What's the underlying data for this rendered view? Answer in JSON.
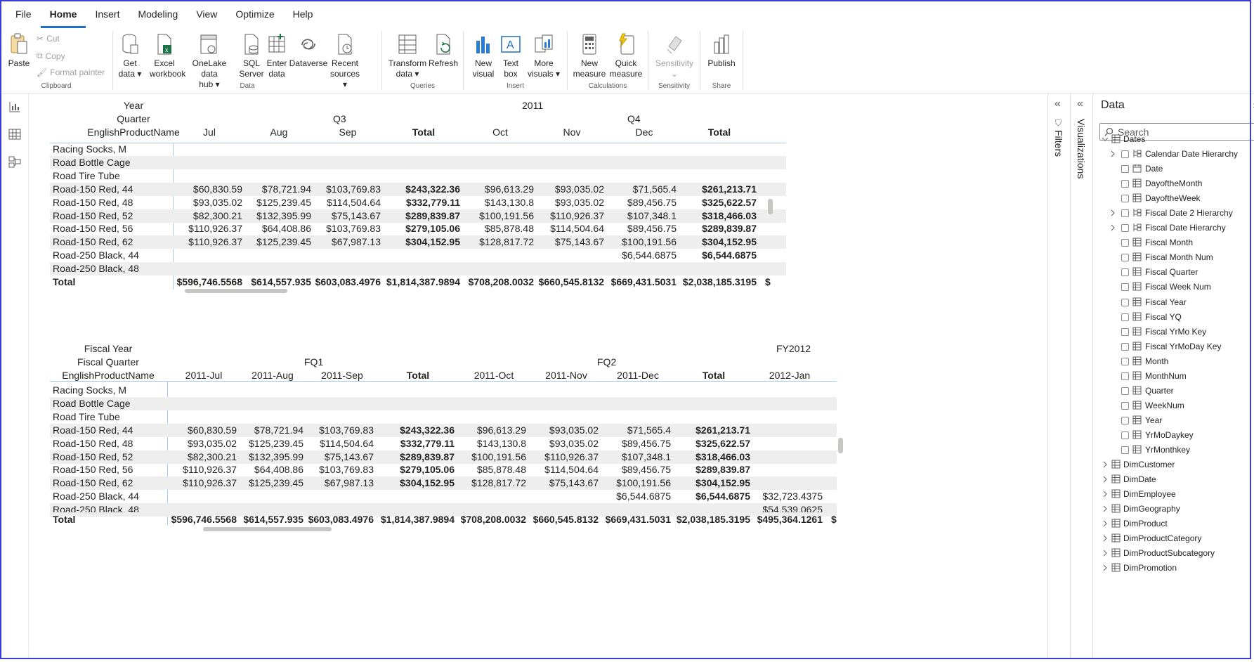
{
  "menu": {
    "items": [
      "File",
      "Home",
      "Insert",
      "Modeling",
      "View",
      "Optimize",
      "Help"
    ],
    "active": "Home"
  },
  "ribbon": {
    "clipboard": {
      "label": "Clipboard",
      "paste": "Paste",
      "cut": "Cut",
      "copy": "Copy",
      "format_painter": "Format painter"
    },
    "data": {
      "label": "Data",
      "get_data": [
        "Get",
        "data"
      ],
      "excel": [
        "Excel",
        "workbook"
      ],
      "onelake": [
        "OneLake data",
        "hub"
      ],
      "sql": [
        "SQL",
        "Server"
      ],
      "enter": [
        "Enter",
        "data"
      ],
      "dataverse": "Dataverse",
      "recent": [
        "Recent",
        "sources"
      ]
    },
    "queries": {
      "label": "Queries",
      "transform": [
        "Transform",
        "data"
      ],
      "refresh": "Refresh"
    },
    "insert": {
      "label": "Insert",
      "new_visual": [
        "New",
        "visual"
      ],
      "text_box": [
        "Text",
        "box"
      ],
      "more_visuals": [
        "More",
        "visuals"
      ]
    },
    "calculations": {
      "label": "Calculations",
      "new_measure": [
        "New",
        "measure"
      ],
      "quick_measure": [
        "Quick",
        "measure"
      ]
    },
    "sensitivity": {
      "label": "Sensitivity",
      "btn": "Sensitivity"
    },
    "share": {
      "label": "Share",
      "publish": "Publish"
    }
  },
  "matrix1": {
    "row_header_labels": [
      "Year",
      "Quarter",
      "EnglishProductName"
    ],
    "year": "2011",
    "quarters": [
      "Q3",
      "Q4"
    ],
    "columns": [
      "Jul",
      "Aug",
      "Sep",
      "Total",
      "Oct",
      "Nov",
      "Dec",
      "Total"
    ],
    "rows": [
      {
        "label": "Racing Socks, M",
        "values": [
          "",
          "",
          "",
          "",
          "",
          "",
          "",
          ""
        ]
      },
      {
        "label": "Road Bottle Cage",
        "values": [
          "",
          "",
          "",
          "",
          "",
          "",
          "",
          ""
        ]
      },
      {
        "label": "Road Tire Tube",
        "values": [
          "",
          "",
          "",
          "",
          "",
          "",
          "",
          ""
        ]
      },
      {
        "label": "Road-150 Red, 44",
        "values": [
          "$60,830.59",
          "$78,721.94",
          "$103,769.83",
          "$243,322.36",
          "$96,613.29",
          "$93,035.02",
          "$71,565.4",
          "$261,213.71"
        ]
      },
      {
        "label": "Road-150 Red, 48",
        "values": [
          "$93,035.02",
          "$125,239.45",
          "$114,504.64",
          "$332,779.11",
          "$143,130.8",
          "$93,035.02",
          "$89,456.75",
          "$325,622.57"
        ]
      },
      {
        "label": "Road-150 Red, 52",
        "values": [
          "$82,300.21",
          "$132,395.99",
          "$75,143.67",
          "$289,839.87",
          "$100,191.56",
          "$110,926.37",
          "$107,348.1",
          "$318,466.03"
        ]
      },
      {
        "label": "Road-150 Red, 56",
        "values": [
          "$110,926.37",
          "$64,408.86",
          "$103,769.83",
          "$279,105.06",
          "$85,878.48",
          "$114,504.64",
          "$89,456.75",
          "$289,839.87"
        ]
      },
      {
        "label": "Road-150 Red, 62",
        "values": [
          "$110,926.37",
          "$125,239.45",
          "$67,987.13",
          "$304,152.95",
          "$128,817.72",
          "$75,143.67",
          "$100,191.56",
          "$304,152.95"
        ]
      },
      {
        "label": "Road-250 Black, 44",
        "values": [
          "",
          "",
          "",
          "",
          "",
          "",
          "$6,544.6875",
          "$6,544.6875"
        ]
      },
      {
        "label": "Road-250 Black, 48",
        "values": [
          "",
          "",
          "",
          "",
          "",
          "",
          "",
          ""
        ]
      }
    ],
    "total": {
      "label": "Total",
      "values": [
        "$596,746.5568",
        "$614,557.935",
        "$603,083.4976",
        "$1,814,387.9894",
        "$708,208.0032",
        "$660,545.8132",
        "$669,431.5031",
        "$2,038,185.3195",
        "$"
      ]
    }
  },
  "matrix2": {
    "row_header_labels": [
      "Fiscal Year",
      "Fiscal Quarter",
      "EnglishProductName"
    ],
    "fiscal_year": "FY2012",
    "quarters": [
      "FQ1",
      "FQ2"
    ],
    "columns": [
      "2011-Jul",
      "2011-Aug",
      "2011-Sep",
      "Total",
      "2011-Oct",
      "2011-Nov",
      "2011-Dec",
      "Total",
      "2012-Jan"
    ],
    "rows": [
      {
        "label": "Racing Socks, M",
        "values": [
          "",
          "",
          "",
          "",
          "",
          "",
          "",
          "",
          ""
        ]
      },
      {
        "label": "Road Bottle Cage",
        "values": [
          "",
          "",
          "",
          "",
          "",
          "",
          "",
          "",
          ""
        ]
      },
      {
        "label": "Road Tire Tube",
        "values": [
          "",
          "",
          "",
          "",
          "",
          "",
          "",
          "",
          ""
        ]
      },
      {
        "label": "Road-150 Red, 44",
        "values": [
          "$60,830.59",
          "$78,721.94",
          "$103,769.83",
          "$243,322.36",
          "$96,613.29",
          "$93,035.02",
          "$71,565.4",
          "$261,213.71",
          ""
        ]
      },
      {
        "label": "Road-150 Red, 48",
        "values": [
          "$93,035.02",
          "$125,239.45",
          "$114,504.64",
          "$332,779.11",
          "$143,130.8",
          "$93,035.02",
          "$89,456.75",
          "$325,622.57",
          ""
        ]
      },
      {
        "label": "Road-150 Red, 52",
        "values": [
          "$82,300.21",
          "$132,395.99",
          "$75,143.67",
          "$289,839.87",
          "$100,191.56",
          "$110,926.37",
          "$107,348.1",
          "$318,466.03",
          ""
        ]
      },
      {
        "label": "Road-150 Red, 56",
        "values": [
          "$110,926.37",
          "$64,408.86",
          "$103,769.83",
          "$279,105.06",
          "$85,878.48",
          "$114,504.64",
          "$89,456.75",
          "$289,839.87",
          ""
        ]
      },
      {
        "label": "Road-150 Red, 62",
        "values": [
          "$110,926.37",
          "$125,239.45",
          "$67,987.13",
          "$304,152.95",
          "$128,817.72",
          "$75,143.67",
          "$100,191.56",
          "$304,152.95",
          ""
        ]
      },
      {
        "label": "Road-250 Black, 44",
        "values": [
          "",
          "",
          "",
          "",
          "",
          "",
          "$6,544.6875",
          "$6,544.6875",
          "$32,723.4375"
        ]
      },
      {
        "label": "Road-250 Black, 48",
        "values": [
          "",
          "",
          "",
          "",
          "",
          "",
          "",
          "",
          "$54,539.0625"
        ]
      }
    ],
    "total": {
      "label": "Total",
      "values": [
        "$596,746.5568",
        "$614,557.935",
        "$603,083.4976",
        "$1,814,387.9894",
        "$708,208.0032",
        "$660,545.8132",
        "$669,431.5031",
        "$2,038,185.3195",
        "$495,364.1261",
        "$"
      ]
    }
  },
  "panes": {
    "filters": "Filters",
    "visualizations": "Visualizations"
  },
  "data_pane": {
    "title": "Data",
    "search_placeholder": "Search",
    "table": "Dates",
    "fields": [
      {
        "name": "Calendar Date Hierarchy",
        "type": "hierarchy",
        "expandable": true
      },
      {
        "name": "Date",
        "type": "date"
      },
      {
        "name": "DayoftheMonth",
        "type": "column"
      },
      {
        "name": "DayoftheWeek",
        "type": "column"
      },
      {
        "name": "Fiscal Date 2 Hierarchy",
        "type": "hierarchy",
        "expandable": true
      },
      {
        "name": "Fiscal Date Hierarchy",
        "type": "hierarchy",
        "expandable": true
      },
      {
        "name": "Fiscal Month",
        "type": "column"
      },
      {
        "name": "Fiscal Month Num",
        "type": "column"
      },
      {
        "name": "Fiscal Quarter",
        "type": "column"
      },
      {
        "name": "Fiscal Week Num",
        "type": "column"
      },
      {
        "name": "Fiscal Year",
        "type": "column"
      },
      {
        "name": "Fiscal YQ",
        "type": "column"
      },
      {
        "name": "Fiscal YrMo Key",
        "type": "column"
      },
      {
        "name": "Fiscal YrMoDay Key",
        "type": "column"
      },
      {
        "name": "Month",
        "type": "column"
      },
      {
        "name": "MonthNum",
        "type": "column"
      },
      {
        "name": "Quarter",
        "type": "column"
      },
      {
        "name": "WeekNum",
        "type": "column"
      },
      {
        "name": "Year",
        "type": "column"
      },
      {
        "name": "YrMoDaykey",
        "type": "column"
      },
      {
        "name": "YrMonthkey",
        "type": "column"
      }
    ],
    "tables": [
      "DimCustomer",
      "DimDate",
      "DimEmployee",
      "DimGeography",
      "DimProduct",
      "DimProductCategory",
      "DimProductSubcategory",
      "DimPromotion"
    ]
  }
}
